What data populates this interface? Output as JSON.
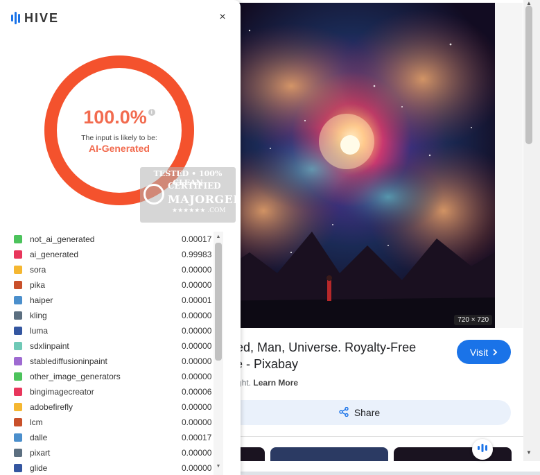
{
  "hive": {
    "brand": "HIVE",
    "close_label": "×",
    "percent": "100.0%",
    "percent_value": 1.0,
    "info_icon": "i",
    "likely_label": "The input is likely to be:",
    "verdict": "AI-Generated",
    "ring_color": "#f4522d",
    "classes": [
      {
        "name": "not_ai_generated",
        "value": "0.00017",
        "color": "#4cc35c"
      },
      {
        "name": "ai_generated",
        "value": "0.99983",
        "color": "#e8365c"
      },
      {
        "name": "sora",
        "value": "0.00000",
        "color": "#f5b731"
      },
      {
        "name": "pika",
        "value": "0.00000",
        "color": "#c9502a"
      },
      {
        "name": "haiper",
        "value": "0.00001",
        "color": "#4b8fcc"
      },
      {
        "name": "kling",
        "value": "0.00000",
        "color": "#5c6f80"
      },
      {
        "name": "luma",
        "value": "0.00000",
        "color": "#3456a0"
      },
      {
        "name": "sdxlinpaint",
        "value": "0.00000",
        "color": "#6fc9b6"
      },
      {
        "name": "stablediffusioninpaint",
        "value": "0.00000",
        "color": "#9e6ad1"
      },
      {
        "name": "other_image_generators",
        "value": "0.00000",
        "color": "#4cc35c"
      },
      {
        "name": "bingimagecreator",
        "value": "0.00006",
        "color": "#e8365c"
      },
      {
        "name": "adobefirefly",
        "value": "0.00000",
        "color": "#f5b731"
      },
      {
        "name": "lcm",
        "value": "0.00000",
        "color": "#c9502a"
      },
      {
        "name": "dalle",
        "value": "0.00017",
        "color": "#4b8fcc"
      },
      {
        "name": "pixart",
        "value": "0.00000",
        "color": "#5c6f80"
      },
      {
        "name": "glide",
        "value": "0.00000",
        "color": "#3456a0"
      }
    ]
  },
  "watermark": {
    "line1": "TESTED • 100% CLEAN",
    "line2": "CERTIFIED",
    "line3": "MAJORGEEKS",
    "line4": "★★★★★★ .COM"
  },
  "result": {
    "dimensions": "720 × 720",
    "title": "nerated, Man, Universe. Royalty-Free Image - Pixabay",
    "visit_label": "Visit",
    "copyright_text": "o copyright.",
    "learn_more": "Learn More",
    "share_label": "Share"
  },
  "icons": {
    "close": "close-icon",
    "info": "info-icon",
    "share": "share-icon",
    "visit_chevron": "chevron-right-icon",
    "hive_logo": "hive-logo-icon"
  }
}
